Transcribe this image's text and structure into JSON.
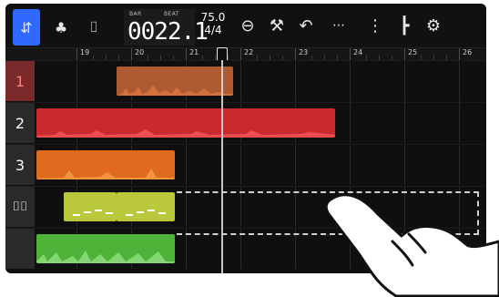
{
  "toolbar": {
    "buttons": [
      {
        "name": "waveform-view-icon",
        "glyph": "⇵"
      },
      {
        "name": "mixer-icon",
        "glyph": "♣"
      },
      {
        "name": "piano-roll-icon",
        "glyph": "⌷"
      }
    ],
    "counter_labels": {
      "bar": "BAR",
      "beat": "BEAT"
    },
    "counter_value": "0022.1",
    "tempo": {
      "bpm": "75.0",
      "sig": "4/4"
    },
    "right_icons": [
      {
        "name": "overdub-icon",
        "glyph": "⊖"
      },
      {
        "name": "hammer-icon",
        "glyph": "🔨"
      },
      {
        "name": "undo-icon",
        "glyph": "↶"
      },
      {
        "name": "quantize-icon",
        "glyph": "⋯"
      },
      {
        "name": "levels-icon",
        "glyph": "⋮"
      },
      {
        "name": "metronome-icon",
        "glyph": "┣"
      },
      {
        "name": "settings-icon",
        "glyph": "⚙"
      }
    ]
  },
  "ruler": {
    "numbers": [
      "19",
      "20",
      "21",
      "22",
      "23",
      "24",
      "25",
      "26"
    ]
  },
  "tracks": [
    {
      "label": "1",
      "color": "#ae5a32",
      "wave": "#e07a45"
    },
    {
      "label": "2",
      "color": "#c92a2e",
      "wave": "#ff5a5a"
    },
    {
      "label": "3",
      "color": "#e06a1d",
      "wave": "#f8a24a"
    },
    {
      "label": "",
      "color": "#b9c83a",
      "wave": "#ffffff"
    },
    {
      "label": "",
      "color": "#4fb33a",
      "wave": "#98e089"
    }
  ],
  "colors": {
    "accent": "#2f69ff",
    "track1": "#ae5a32",
    "track2": "#c92a2e",
    "track3": "#e06a1d",
    "track4": "#b9c83a",
    "track5": "#4fb33a"
  }
}
